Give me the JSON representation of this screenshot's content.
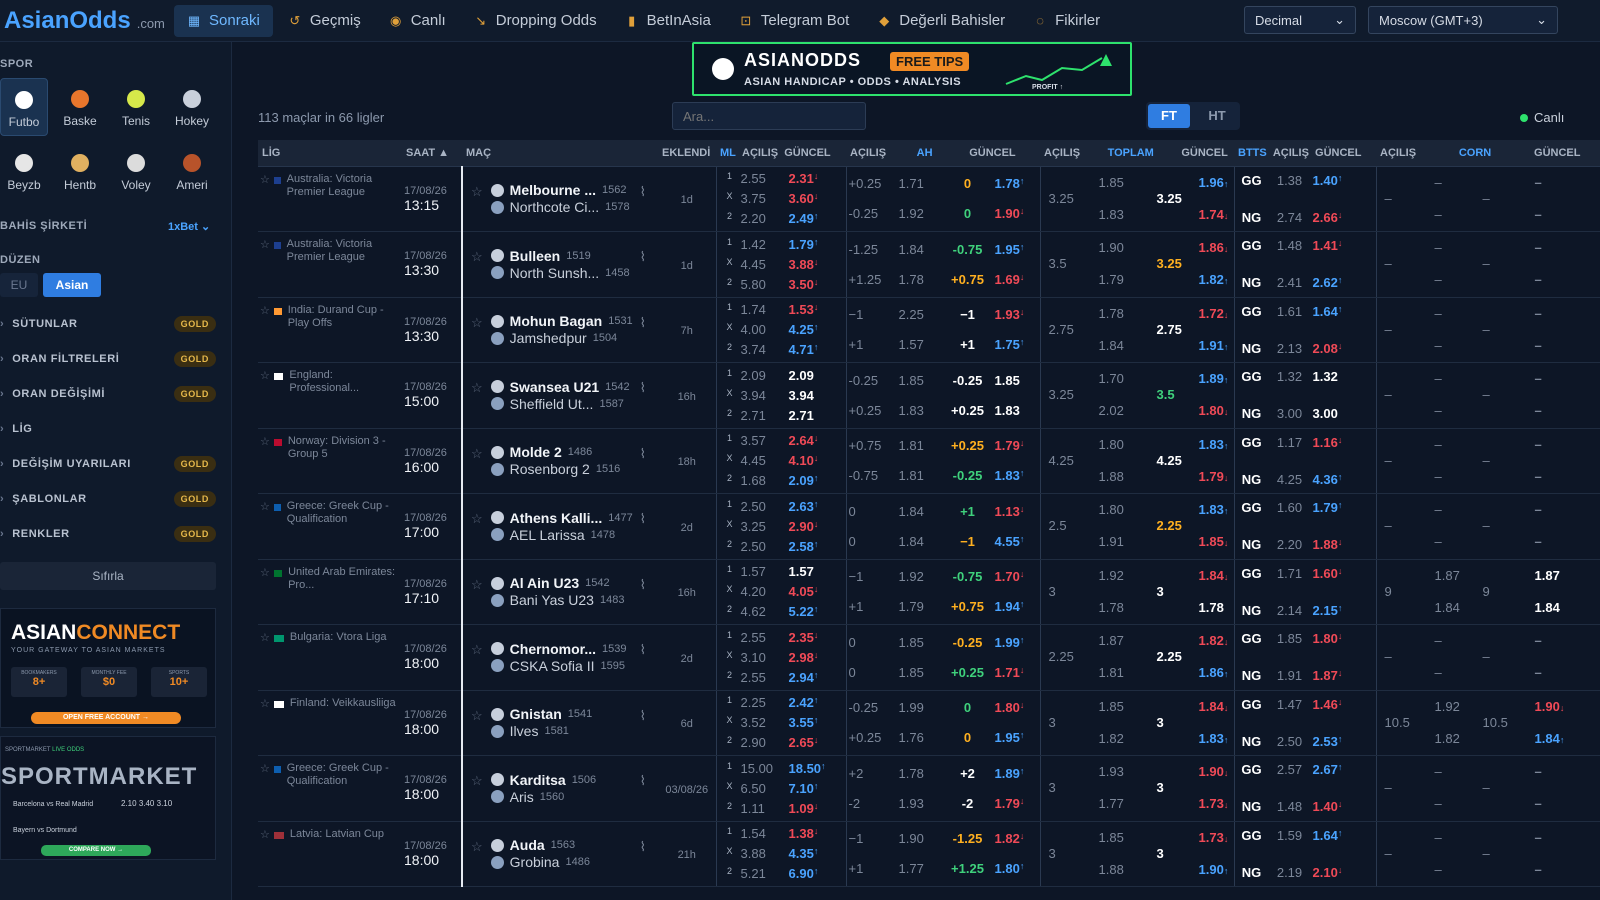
{
  "brand": {
    "name": "AsianOdds",
    "suffix": ".com"
  },
  "nav": [
    {
      "label": "Sonraki",
      "icon": "calendar-icon"
    },
    {
      "label": "Geçmiş",
      "icon": "history-icon"
    },
    {
      "label": "Canlı",
      "icon": "live-icon"
    },
    {
      "label": "Dropping Odds",
      "icon": "trend-down-icon"
    },
    {
      "label": "BetInAsia",
      "icon": "bar-chart-icon"
    },
    {
      "label": "Telegram Bot",
      "icon": "bot-icon"
    },
    {
      "label": "Değerli Bahisler",
      "icon": "diamond-icon"
    },
    {
      "label": "Fikirler",
      "icon": "bulb-icon"
    }
  ],
  "odds_format": "Decimal",
  "timezone": "Moscow (GMT+3)",
  "sidebar": {
    "sport_title": "SPOR",
    "sports": [
      {
        "label": "Futbo",
        "icon": "football-icon"
      },
      {
        "label": "Baske",
        "icon": "basketball-icon"
      },
      {
        "label": "Tenis",
        "icon": "tennis-icon"
      },
      {
        "label": "Hokey",
        "icon": "hockey-icon"
      },
      {
        "label": "Beyzb",
        "icon": "baseball-icon"
      },
      {
        "label": "Hentb",
        "icon": "handball-icon"
      },
      {
        "label": "Voley",
        "icon": "volleyball-icon"
      },
      {
        "label": "Ameri",
        "icon": "american-football-icon"
      }
    ],
    "bookmaker_title": "BAHİS ŞİRKETİ",
    "bookmaker": "1xBet",
    "layout_title": "DÜZEN",
    "layout_eu": "EU",
    "layout_asian": "Asian",
    "rows": [
      {
        "label": "SÜTUNLAR",
        "gold": "GOLD"
      },
      {
        "label": "ORAN FİLTRELERİ",
        "gold": "GOLD"
      },
      {
        "label": "ORAN DEĞİŞİMİ",
        "gold": "GOLD"
      },
      {
        "label": "LİG",
        "gold": ""
      },
      {
        "label": "DEĞİŞİM UYARILARI",
        "gold": "GOLD"
      },
      {
        "label": "ŞABLONLAR",
        "gold": "GOLD"
      },
      {
        "label": "RENKLER",
        "gold": "GOLD"
      }
    ],
    "reset": "Sıfırla",
    "ad1": {
      "title_a": "ASIAN",
      "title_b": "CONNECT",
      "sub": "YOUR GATEWAY TO ASIAN MARKETS",
      "cta": "OPEN FREE ACCOUNT →",
      "s1l": "BOOKMAKERS",
      "s1v": "8+",
      "s2l": "MONTHLY FEE",
      "s2v": "$0",
      "s3l": "SPORTS",
      "s3v": "10+"
    },
    "ad2": {
      "brand": "SPORTMARKET",
      "tag": "LIVE ODDS",
      "cta": "COMPARE NOW →",
      "row1": "Barcelona vs Real Madrid",
      "row2": "Bayern vs Dortmund",
      "o1": "2.10",
      "o2": "3.40",
      "o3": "3.10"
    }
  },
  "banner": {
    "brand": "ASIANODDS",
    "tips": "FREE TIPS",
    "sub": "ASIAN HANDICAP • ODDS • ANALYSIS",
    "profit": "PROFIT ↑"
  },
  "summary": "113 maçlar in 66 ligler",
  "search_placeholder": "Ara...",
  "ft": "FT",
  "ht": "HT",
  "live_label": "Canlı",
  "headers": {
    "lig": "LİG",
    "saat": "SAAT ▲",
    "mac": "MAÇ",
    "eklendi": "EKLENDİ",
    "ml": "ML",
    "acilis": "AÇILIŞ",
    "guncel": "GÜNCEL",
    "ah": "AH",
    "toplam": "TOPLAM",
    "btts": "BTTS",
    "corn": "CORN"
  },
  "matches": [
    {
      "league": "Australia: Victoria Premier League",
      "flag": "#1d3f8f",
      "date": "17/08/26",
      "time": "13:15",
      "home": "Melbourne ...",
      "he": "1562",
      "away": "Northcote Ci...",
      "ae": "1578",
      "added": "1d",
      "ml_o": [
        "2.55",
        "3.75",
        "2.20"
      ],
      "ml_c": [
        [
          "2.31",
          "dn"
        ],
        [
          "3.60",
          "dn"
        ],
        [
          "2.49",
          "up"
        ]
      ],
      "ah": [
        [
          "+0.25",
          "1.71",
          "0",
          "or",
          "1.78",
          "up"
        ],
        [
          "-0.25",
          "1.92",
          "0",
          "gr",
          "1.90",
          "dn"
        ]
      ],
      "tot": {
        "line": "3.25",
        "o1": "1.85",
        "o2": "1.83",
        "cl": "3.25",
        "clc": "wh",
        "c1": [
          "1.96",
          "up"
        ],
        "c2": [
          "1.74",
          "dn"
        ]
      },
      "btts": [
        [
          "GG",
          "1.38",
          "1.40",
          "up"
        ],
        [
          "NG",
          "2.74",
          "2.66",
          "dn"
        ]
      ],
      "corn": {
        "line": "–",
        "o1": "–",
        "o2": "–",
        "cl": "–",
        "c1": [
          "–",
          "mu"
        ],
        "c2": [
          "–",
          "mu"
        ]
      }
    },
    {
      "league": "Australia: Victoria Premier League",
      "flag": "#1d3f8f",
      "date": "17/08/26",
      "time": "13:30",
      "home": "Bulleen",
      "he": "1519",
      "away": "North Sunsh...",
      "ae": "1458",
      "added": "1d",
      "ml_o": [
        "1.42",
        "4.45",
        "5.80"
      ],
      "ml_c": [
        [
          "1.79",
          "up"
        ],
        [
          "3.88",
          "dn"
        ],
        [
          "3.50",
          "dn"
        ]
      ],
      "ah": [
        [
          "-1.25",
          "1.84",
          "-0.75",
          "gr",
          "1.95",
          "up"
        ],
        [
          "+1.25",
          "1.78",
          "+0.75",
          "or",
          "1.69",
          "dn"
        ]
      ],
      "tot": {
        "line": "3.5",
        "o1": "1.90",
        "o2": "1.79",
        "cl": "3.25",
        "clc": "or",
        "c1": [
          "1.86",
          "dn"
        ],
        "c2": [
          "1.82",
          "up"
        ]
      },
      "btts": [
        [
          "GG",
          "1.48",
          "1.41",
          "dn"
        ],
        [
          "NG",
          "2.41",
          "2.62",
          "up"
        ]
      ],
      "corn": {
        "line": "–",
        "o1": "–",
        "o2": "–",
        "cl": "–",
        "c1": [
          "–",
          "mu"
        ],
        "c2": [
          "–",
          "mu"
        ]
      }
    },
    {
      "league": "India: Durand Cup - Play Offs",
      "flag": "#ff9933",
      "date": "17/08/26",
      "time": "13:30",
      "home": "Mohun Bagan",
      "he": "1531",
      "away": "Jamshedpur",
      "ae": "1504",
      "added": "7h",
      "ml_o": [
        "1.74",
        "4.00",
        "3.74"
      ],
      "ml_c": [
        [
          "1.53",
          "dn"
        ],
        [
          "4.25",
          "up"
        ],
        [
          "4.71",
          "up"
        ]
      ],
      "ah": [
        [
          "−1",
          "2.25",
          "−1",
          "wh",
          "1.93",
          "dn"
        ],
        [
          "+1",
          "1.57",
          "+1",
          "wh",
          "1.75",
          "up"
        ]
      ],
      "tot": {
        "line": "2.75",
        "o1": "1.78",
        "o2": "1.84",
        "cl": "2.75",
        "clc": "wh",
        "c1": [
          "1.72",
          "dn"
        ],
        "c2": [
          "1.91",
          "up"
        ]
      },
      "btts": [
        [
          "GG",
          "1.61",
          "1.64",
          "up"
        ],
        [
          "NG",
          "2.13",
          "2.08",
          "dn"
        ]
      ],
      "corn": {
        "line": "–",
        "o1": "–",
        "o2": "–",
        "cl": "–",
        "c1": [
          "–",
          "mu"
        ],
        "c2": [
          "–",
          "mu"
        ]
      }
    },
    {
      "league": "England: Professional...",
      "flag": "#ffffff",
      "date": "17/08/26",
      "time": "15:00",
      "home": "Swansea U21",
      "he": "1542",
      "away": "Sheffield Ut...",
      "ae": "1587",
      "added": "16h",
      "ml_o": [
        "2.09",
        "3.94",
        "2.71"
      ],
      "ml_c": [
        [
          "2.09",
          "wh"
        ],
        [
          "3.94",
          "wh"
        ],
        [
          "2.71",
          "wh"
        ]
      ],
      "ah": [
        [
          "-0.25",
          "1.85",
          "-0.25",
          "wh",
          "1.85",
          "wh"
        ],
        [
          "+0.25",
          "1.83",
          "+0.25",
          "wh",
          "1.83",
          "wh"
        ]
      ],
      "tot": {
        "line": "3.25",
        "o1": "1.70",
        "o2": "2.02",
        "cl": "3.5",
        "clc": "gr",
        "c1": [
          "1.89",
          "up"
        ],
        "c2": [
          "1.80",
          "dn"
        ]
      },
      "btts": [
        [
          "GG",
          "1.32",
          "1.32",
          "wh"
        ],
        [
          "NG",
          "3.00",
          "3.00",
          "wh"
        ]
      ],
      "corn": {
        "line": "–",
        "o1": "–",
        "o2": "–",
        "cl": "–",
        "c1": [
          "–",
          "mu"
        ],
        "c2": [
          "–",
          "mu"
        ]
      }
    },
    {
      "league": "Norway: Division 3 - Group 5",
      "flag": "#ba0c2f",
      "date": "17/08/26",
      "time": "16:00",
      "home": "Molde 2",
      "he": "1486",
      "away": "Rosenborg 2",
      "ae": "1516",
      "added": "18h",
      "ml_o": [
        "3.57",
        "4.45",
        "1.68"
      ],
      "ml_c": [
        [
          "2.64",
          "dn"
        ],
        [
          "4.10",
          "dn"
        ],
        [
          "2.09",
          "up"
        ]
      ],
      "ah": [
        [
          "+0.75",
          "1.81",
          "+0.25",
          "or",
          "1.79",
          "dn"
        ],
        [
          "-0.75",
          "1.81",
          "-0.25",
          "gr",
          "1.83",
          "up"
        ]
      ],
      "tot": {
        "line": "4.25",
        "o1": "1.80",
        "o2": "1.88",
        "cl": "4.25",
        "clc": "wh",
        "c1": [
          "1.83",
          "up"
        ],
        "c2": [
          "1.79",
          "dn"
        ]
      },
      "btts": [
        [
          "GG",
          "1.17",
          "1.16",
          "dn"
        ],
        [
          "NG",
          "4.25",
          "4.36",
          "up"
        ]
      ],
      "corn": {
        "line": "–",
        "o1": "–",
        "o2": "–",
        "cl": "–",
        "c1": [
          "–",
          "mu"
        ],
        "c2": [
          "–",
          "mu"
        ]
      }
    },
    {
      "league": "Greece: Greek Cup - Qualification",
      "flag": "#0d5eaf",
      "date": "17/08/26",
      "time": "17:00",
      "home": "Athens Kalli...",
      "he": "1477",
      "away": "AEL Larissa",
      "ae": "1478",
      "added": "2d",
      "ml_o": [
        "2.50",
        "3.25",
        "2.50"
      ],
      "ml_c": [
        [
          "2.63",
          "up"
        ],
        [
          "2.90",
          "dn"
        ],
        [
          "2.58",
          "up"
        ]
      ],
      "ah": [
        [
          "0",
          "1.84",
          "+1",
          "gr",
          "1.13",
          "dn"
        ],
        [
          "0",
          "1.84",
          "−1",
          "or",
          "4.55",
          "up"
        ]
      ],
      "tot": {
        "line": "2.5",
        "o1": "1.80",
        "o2": "1.91",
        "cl": "2.25",
        "clc": "or",
        "c1": [
          "1.83",
          "up"
        ],
        "c2": [
          "1.85",
          "dn"
        ]
      },
      "btts": [
        [
          "GG",
          "1.60",
          "1.79",
          "up"
        ],
        [
          "NG",
          "2.20",
          "1.88",
          "dn"
        ]
      ],
      "corn": {
        "line": "–",
        "o1": "–",
        "o2": "–",
        "cl": "–",
        "c1": [
          "–",
          "mu"
        ],
        "c2": [
          "–",
          "mu"
        ]
      }
    },
    {
      "league": "United Arab Emirates: Pro...",
      "flag": "#00732f",
      "date": "17/08/26",
      "time": "17:10",
      "home": "Al Ain U23",
      "he": "1542",
      "away": "Bani Yas U23",
      "ae": "1483",
      "added": "16h",
      "ml_o": [
        "1.57",
        "4.20",
        "4.62"
      ],
      "ml_c": [
        [
          "1.57",
          "wh"
        ],
        [
          "4.05",
          "dn"
        ],
        [
          "5.22",
          "up"
        ]
      ],
      "ah": [
        [
          "−1",
          "1.92",
          "-0.75",
          "gr",
          "1.70",
          "dn"
        ],
        [
          "+1",
          "1.79",
          "+0.75",
          "or",
          "1.94",
          "up"
        ]
      ],
      "tot": {
        "line": "3",
        "o1": "1.92",
        "o2": "1.78",
        "cl": "3",
        "clc": "wh",
        "c1": [
          "1.84",
          "dn"
        ],
        "c2": [
          "1.78",
          "wh"
        ]
      },
      "btts": [
        [
          "GG",
          "1.71",
          "1.60",
          "dn"
        ],
        [
          "NG",
          "2.14",
          "2.15",
          "up"
        ]
      ],
      "corn": {
        "line": "9",
        "o1": "1.87",
        "o2": "1.84",
        "cl": "9",
        "c1": [
          "1.87",
          "wh"
        ],
        "c2": [
          "1.84",
          "wh"
        ]
      }
    },
    {
      "league": "Bulgaria: Vtora Liga",
      "flag": "#00966e",
      "date": "17/08/26",
      "time": "18:00",
      "home": "Chernomor...",
      "he": "1539",
      "away": "CSKA Sofia II",
      "ae": "1595",
      "added": "2d",
      "ml_o": [
        "2.55",
        "3.10",
        "2.55"
      ],
      "ml_c": [
        [
          "2.35",
          "dn"
        ],
        [
          "2.98",
          "dn"
        ],
        [
          "2.94",
          "up"
        ]
      ],
      "ah": [
        [
          "0",
          "1.85",
          "-0.25",
          "or",
          "1.99",
          "up"
        ],
        [
          "0",
          "1.85",
          "+0.25",
          "gr",
          "1.71",
          "dn"
        ]
      ],
      "tot": {
        "line": "2.25",
        "o1": "1.87",
        "o2": "1.81",
        "cl": "2.25",
        "clc": "wh",
        "c1": [
          "1.82",
          "dn"
        ],
        "c2": [
          "1.86",
          "up"
        ]
      },
      "btts": [
        [
          "GG",
          "1.85",
          "1.80",
          "dn"
        ],
        [
          "NG",
          "1.91",
          "1.87",
          "dn"
        ]
      ],
      "corn": {
        "line": "–",
        "o1": "–",
        "o2": "–",
        "cl": "–",
        "c1": [
          "–",
          "mu"
        ],
        "c2": [
          "–",
          "mu"
        ]
      }
    },
    {
      "league": "Finland: Veikkausliiga",
      "flag": "#ffffff",
      "date": "17/08/26",
      "time": "18:00",
      "home": "Gnistan",
      "he": "1541",
      "away": "Ilves",
      "ae": "1581",
      "added": "6d",
      "ml_o": [
        "2.25",
        "3.52",
        "2.90"
      ],
      "ml_c": [
        [
          "2.42",
          "up"
        ],
        [
          "3.55",
          "up"
        ],
        [
          "2.65",
          "dn"
        ]
      ],
      "ah": [
        [
          "-0.25",
          "1.99",
          "0",
          "gr",
          "1.80",
          "dn"
        ],
        [
          "+0.25",
          "1.76",
          "0",
          "or",
          "1.95",
          "up"
        ]
      ],
      "tot": {
        "line": "3",
        "o1": "1.85",
        "o2": "1.82",
        "cl": "3",
        "clc": "wh",
        "c1": [
          "1.84",
          "dn"
        ],
        "c2": [
          "1.83",
          "up"
        ]
      },
      "btts": [
        [
          "GG",
          "1.47",
          "1.46",
          "dn"
        ],
        [
          "NG",
          "2.50",
          "2.53",
          "up"
        ]
      ],
      "corn": {
        "line": "10.5",
        "o1": "1.92",
        "o2": "1.82",
        "cl": "10.5",
        "c1": [
          "1.90",
          "dn"
        ],
        "c2": [
          "1.84",
          "up"
        ]
      }
    },
    {
      "league": "Greece: Greek Cup - Qualification",
      "flag": "#0d5eaf",
      "date": "17/08/26",
      "time": "18:00",
      "home": "Karditsa",
      "he": "1506",
      "away": "Aris",
      "ae": "1560",
      "added": "03/08/26",
      "ml_o": [
        "15.00",
        "6.50",
        "1.11"
      ],
      "ml_c": [
        [
          "18.50",
          "up"
        ],
        [
          "7.10",
          "up"
        ],
        [
          "1.09",
          "dn"
        ]
      ],
      "ah": [
        [
          "+2",
          "1.78",
          "+2",
          "wh",
          "1.89",
          "up"
        ],
        [
          "-2",
          "1.93",
          "-2",
          "wh",
          "1.79",
          "dn"
        ]
      ],
      "tot": {
        "line": "3",
        "o1": "1.93",
        "o2": "1.77",
        "cl": "3",
        "clc": "wh",
        "c1": [
          "1.90",
          "dn"
        ],
        "c2": [
          "1.73",
          "dn"
        ]
      },
      "btts": [
        [
          "GG",
          "2.57",
          "2.67",
          "up"
        ],
        [
          "NG",
          "1.48",
          "1.40",
          "dn"
        ]
      ],
      "corn": {
        "line": "–",
        "o1": "–",
        "o2": "–",
        "cl": "–",
        "c1": [
          "–",
          "mu"
        ],
        "c2": [
          "–",
          "mu"
        ]
      }
    },
    {
      "league": "Latvia: Latvian Cup",
      "flag": "#9e3039",
      "date": "17/08/26",
      "time": "18:00",
      "home": "Auda",
      "he": "1563",
      "away": "Grobina",
      "ae": "1486",
      "added": "21h",
      "ml_o": [
        "1.54",
        "3.88",
        "5.21"
      ],
      "ml_c": [
        [
          "1.38",
          "dn"
        ],
        [
          "4.35",
          "up"
        ],
        [
          "6.90",
          "up"
        ]
      ],
      "ah": [
        [
          "−1",
          "1.90",
          "-1.25",
          "or",
          "1.82",
          "dn"
        ],
        [
          "+1",
          "1.77",
          "+1.25",
          "gr",
          "1.80",
          "up"
        ]
      ],
      "tot": {
        "line": "3",
        "o1": "1.85",
        "o2": "1.88",
        "cl": "3",
        "clc": "wh",
        "c1": [
          "1.73",
          "dn"
        ],
        "c2": [
          "1.90",
          "up"
        ]
      },
      "btts": [
        [
          "GG",
          "1.59",
          "1.64",
          "up"
        ],
        [
          "NG",
          "2.19",
          "2.10",
          "dn"
        ]
      ],
      "corn": {
        "line": "–",
        "o1": "–",
        "o2": "–",
        "cl": "–",
        "c1": [
          "–",
          "mu"
        ],
        "c2": [
          "–",
          "mu"
        ]
      }
    }
  ]
}
